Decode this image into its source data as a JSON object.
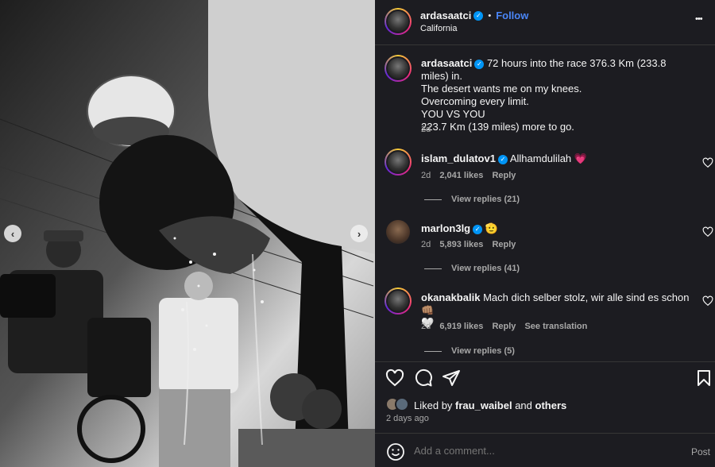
{
  "post": {
    "username": "ardasaatci",
    "location": "California",
    "follow_label": "Follow",
    "dot": "•",
    "more_label": "•••"
  },
  "caption": {
    "username": "ardasaatci",
    "lines": [
      "72 hours into the race 376.3 Km (233.8 miles) in.",
      "The desert wants me on my knees.",
      "Overcoming every limit.",
      "YOU VS YOU",
      "223.7 Km (139 miles) more to go."
    ],
    "time": "2d"
  },
  "comments": [
    {
      "username": "islam_dulatov1",
      "text": "Allhamdulilah",
      "emoji": "💗",
      "time": "2d",
      "likes": "2,041 likes",
      "reply": "Reply",
      "view_replies": "View replies (21)"
    },
    {
      "username": "marlon3lg",
      "text": "",
      "emoji": "🫡",
      "time": "2d",
      "likes": "5,893 likes",
      "reply": "Reply",
      "view_replies": "View replies (41)"
    },
    {
      "username": "okanakbalik",
      "text": "Mach dich selber stolz, wir alle sind es schon",
      "emoji": "👊🏽",
      "emoji2": "🤍",
      "time": "2d",
      "likes": "6,919 likes",
      "reply": "Reply",
      "translation": "See translation",
      "view_replies": "View replies (5)"
    }
  ],
  "likes": {
    "liked_by": "Liked by",
    "user": "frau_waibel",
    "and": "and",
    "others": "others",
    "time_ago": "2 days ago"
  },
  "comment_box": {
    "placeholder": "Add a comment...",
    "post_label": "Post"
  },
  "nav": {
    "prev": "‹",
    "next": "›"
  },
  "colors": {
    "panel_bg": "#1c1c21",
    "follow": "#4a86f7",
    "verified": "#0095f6"
  }
}
